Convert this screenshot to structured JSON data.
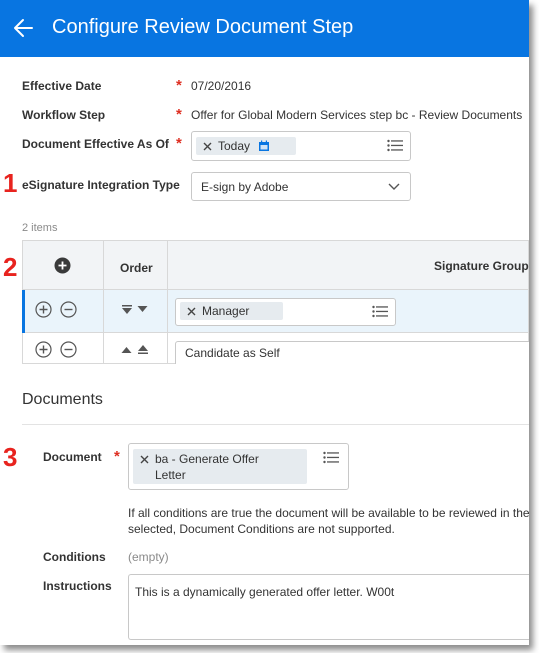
{
  "header": {
    "title": "Configure Review Document Step"
  },
  "fields": {
    "effective_date": {
      "label": "Effective Date",
      "value": "07/20/2016"
    },
    "workflow_step": {
      "label": "Workflow Step",
      "value": "Offer for Global Modern Services step bc - Review Documents"
    },
    "document_effective_as_of": {
      "label": "Document Effective As Of",
      "value": "Today"
    },
    "esignature_integration_type": {
      "label": "eSignature Integration Type",
      "value": "E-sign by Adobe"
    }
  },
  "grid": {
    "item_count": "2 items",
    "columns": {
      "order": "Order",
      "signature_group": "Signature Group"
    },
    "rows": [
      {
        "signature_group": "Manager"
      },
      {
        "signature_group": "Candidate as Self"
      }
    ]
  },
  "documents": {
    "heading": "Documents",
    "document": {
      "label": "Document",
      "value_line1": "ba - Generate Offer",
      "value_line2": "Letter"
    },
    "note_line1": "If all conditions are true the document will be available to be reviewed in the",
    "note_line2": "selected, Document Conditions are not supported.",
    "conditions": {
      "label": "Conditions",
      "value": "(empty)"
    },
    "instructions": {
      "label": "Instructions",
      "value": "This is a dynamically generated offer letter. W00t"
    }
  },
  "annotations": [
    "1",
    "2",
    "3"
  ],
  "colors": {
    "header_bg": "#0875e1",
    "required": "#de2e21",
    "annotation": "#e8231e",
    "selected_row_bg": "#eaf4fb",
    "selected_row_accent": "#0875e1"
  }
}
